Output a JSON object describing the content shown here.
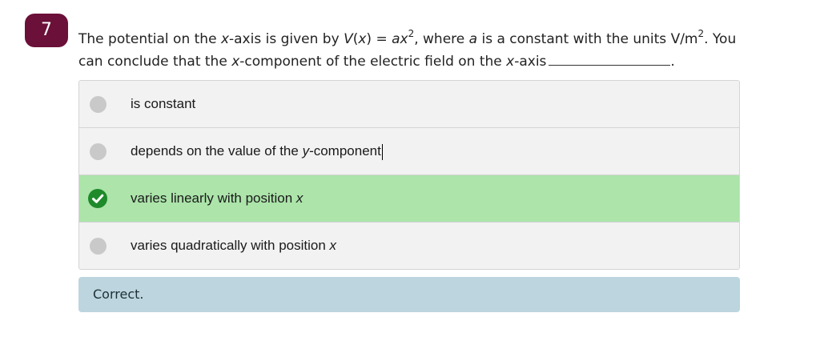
{
  "question": {
    "number": "7",
    "text": {
      "p1": "The potential on the ",
      "x1": "x",
      "p2": "-axis is given by ",
      "V": "V",
      "p3": "(",
      "x2": "x",
      "p4": ") = ",
      "a1": "a",
      "x3": "x",
      "exp1": "2",
      "p5": ", where ",
      "a2": "a",
      "p6": " is a constant with the units V/m",
      "exp2": "2",
      "p7": ". You can conclude that the ",
      "x4": "x",
      "p8": "-component of the electric field on the ",
      "x5": "x",
      "p9": "-axis",
      "end": "."
    }
  },
  "options": [
    {
      "label": "is constant",
      "state": "unselected"
    },
    {
      "label_pre": "depends on the value of the ",
      "label_var": "y",
      "label_post": "-component",
      "state": "unselected",
      "has_caret": true
    },
    {
      "label_pre": "varies linearly with position ",
      "label_var": "x",
      "state": "correct-selected"
    },
    {
      "label_pre": "varies quadratically with position ",
      "label_var": "x",
      "state": "unselected"
    }
  ],
  "feedback": {
    "text": "Correct."
  },
  "colors": {
    "badge": "#6b1038",
    "selected_bg": "#ace4aa",
    "check": "#1e8a2a",
    "feedback_bg": "#bcd5df"
  },
  "icons": {
    "radio": "radio-empty-icon",
    "check": "check-circle-icon"
  }
}
